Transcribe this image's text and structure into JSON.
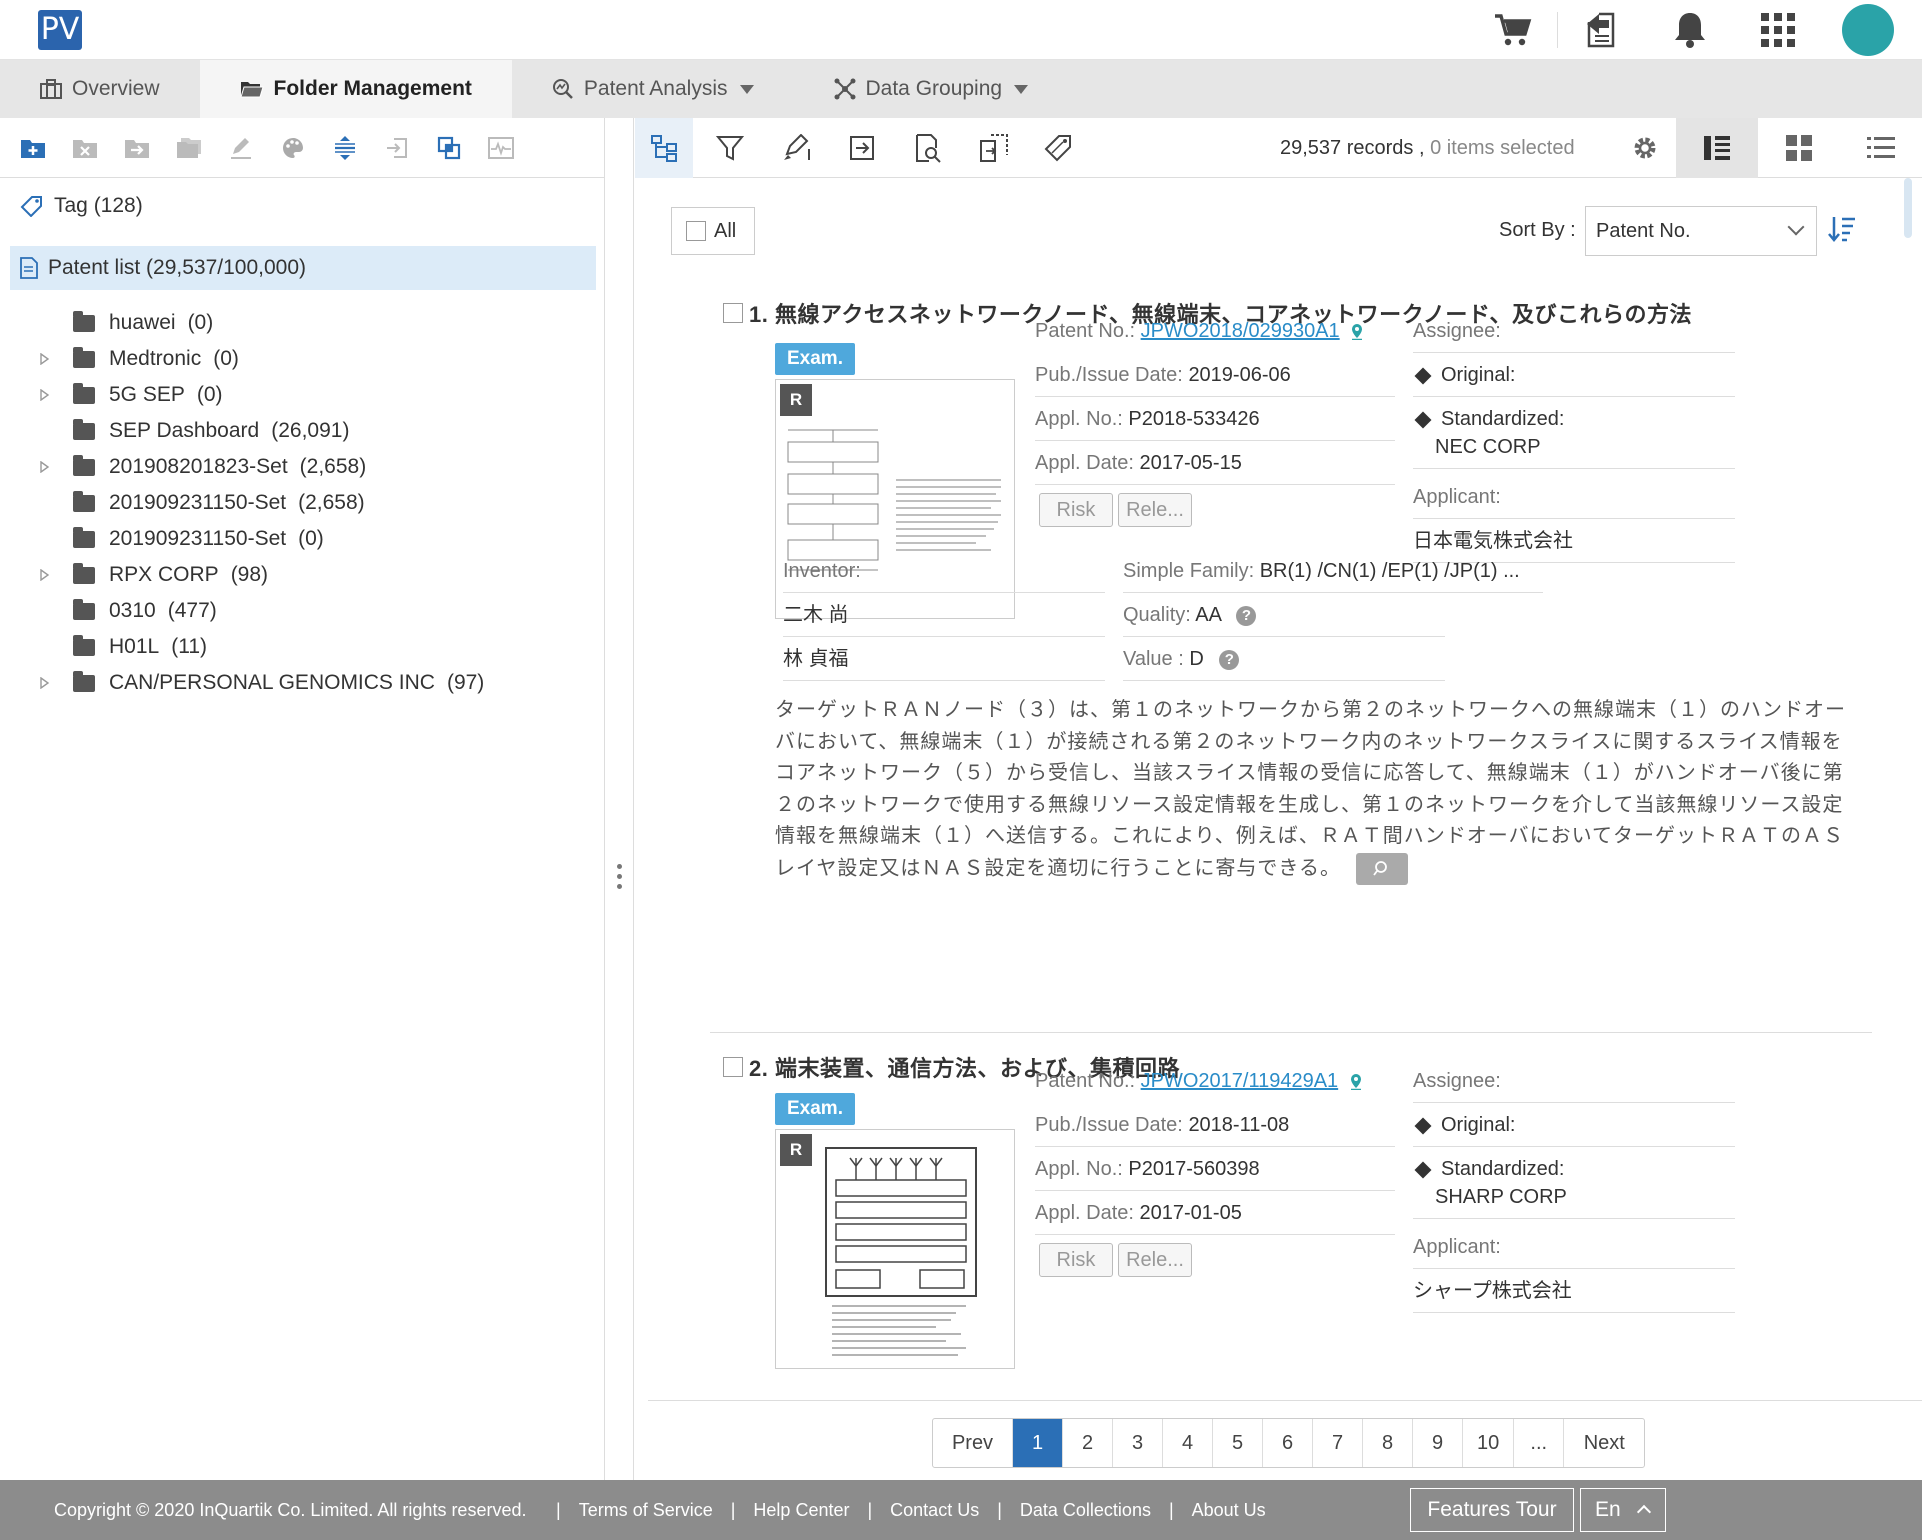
{
  "app": {
    "logo_text": "PV",
    "avatar_color": "#2aa3a8",
    "accent": "#2b6fb6"
  },
  "topbar": {
    "icons": [
      "cart-icon",
      "export-icon",
      "bell-icon",
      "apps-grid-icon",
      "avatar"
    ]
  },
  "nav": {
    "tabs": [
      {
        "label": "Overview",
        "icon": "briefcase-icon"
      },
      {
        "label": "Folder Management",
        "icon": "folder-open-icon"
      },
      {
        "label": "Patent Analysis",
        "icon": "analysis-icon"
      },
      {
        "label": "Data Grouping",
        "icon": "grouping-icon"
      }
    ]
  },
  "sidebar": {
    "tag_label": "Tag (128)",
    "patent_list_label": "Patent list (29,537/100,000)",
    "folders": [
      {
        "name": "huawei",
        "count": "(0)",
        "expandable": false
      },
      {
        "name": "Medtronic",
        "count": "(0)",
        "expandable": true
      },
      {
        "name": "5G SEP",
        "count": "(0)",
        "expandable": true
      },
      {
        "name": "SEP Dashboard",
        "count": "(26,091)",
        "expandable": false
      },
      {
        "name": "201908201823-Set",
        "count": "(2,658)",
        "expandable": true
      },
      {
        "name": "201909231150-Set",
        "count": "(2,658)",
        "expandable": false
      },
      {
        "name": "201909231150-Set",
        "count": "(0)",
        "expandable": false
      },
      {
        "name": "RPX CORP",
        "count": "(98)",
        "expandable": true
      },
      {
        "name": "0310",
        "count": "(477)",
        "expandable": false
      },
      {
        "name": "H01L",
        "count": "(11)",
        "expandable": false
      },
      {
        "name": "CAN/PERSONAL GENOMICS INC",
        "count": "(97)",
        "expandable": true
      }
    ]
  },
  "toolbar": {
    "records": "29,537 records ,",
    "selected": " 0 items selected",
    "all_label": "All",
    "sort_label": "Sort By :",
    "sort_value": "Patent No."
  },
  "patents": [
    {
      "title": "1. 無線アクセスネットワークノード、無線端末、コアネットワークノード、及びこれらの方法",
      "badge": "Exam.",
      "r_badge": "R",
      "patent_no_label": "Patent No.:",
      "patent_no": "JPWO2018/029930A1",
      "pub_label": "Pub./Issue Date:",
      "pub_date": "2019-06-06",
      "appl_no_label": "Appl. No.:",
      "appl_no": "P2018-533426",
      "appl_date_label": "Appl. Date:",
      "appl_date": "2017-05-15",
      "risk_label": "Risk",
      "rele_label": "Rele...",
      "assignee_label": "Assignee:",
      "original_label": "Original:",
      "standardized_label": "Standardized:",
      "standardized": "NEC CORP",
      "applicant_label": "Applicant:",
      "applicant": "日本電気株式会社",
      "inventor_label": "Inventor:",
      "inventors": [
        "二木 尚",
        "林 貞福"
      ],
      "family_label": "Simple Family:",
      "family": "BR(1) /CN(1) /EP(1) /JP(1) ...",
      "quality_label": "Quality:",
      "quality": "AA",
      "value_label": "Value :",
      "value": "D",
      "abstract": "ターゲットＲＡＮノード（３）は、第１のネットワークから第２のネットワークへの無線端末（１）のハンドオーバにおいて、無線端末（１）が接続される第２のネットワーク内のネットワークスライスに関するスライス情報をコアネットワーク（５）から受信し、当該スライス情報の受信に応答して、無線端末（１）がハンドオーバ後に第２のネットワークで使用する無線リソース設定情報を生成し、第１のネットワークを介して当該無線リソース設定情報を無線端末（１）へ送信する。これにより、例えば、ＲＡＴ間ハンドオーバにおいてターゲットＲＡＴのＡＳレイヤ設定又はＮＡＳ設定を適切に行うことに寄与できる。"
    },
    {
      "title": "2. 端末装置、通信方法、および、集積回路",
      "badge": "Exam.",
      "r_badge": "R",
      "patent_no_label": "Patent No.:",
      "patent_no": "JPWO2017/119429A1",
      "pub_label": "Pub./Issue Date:",
      "pub_date": "2018-11-08",
      "appl_no_label": "Appl. No.:",
      "appl_no": "P2017-560398",
      "appl_date_label": "Appl. Date:",
      "appl_date": "2017-01-05",
      "risk_label": "Risk",
      "rele_label": "Rele...",
      "assignee_label": "Assignee:",
      "original_label": "Original:",
      "standardized_label": "Standardized:",
      "standardized": "SHARP CORP",
      "applicant_label": "Applicant:",
      "applicant": "シャープ株式会社"
    }
  ],
  "pagination": {
    "prev": "Prev",
    "pages": [
      "1",
      "2",
      "3",
      "4",
      "5",
      "6",
      "7",
      "8",
      "9",
      "10",
      "..."
    ],
    "current": "1",
    "next": "Next"
  },
  "footer": {
    "copyright": "Copyright © 2020 InQuartik Co. Limited. All rights reserved.",
    "links": [
      "Terms of Service",
      "Help Center",
      "Contact Us",
      "Data Collections",
      "About Us"
    ],
    "features_tour": "Features Tour",
    "language": "En"
  }
}
